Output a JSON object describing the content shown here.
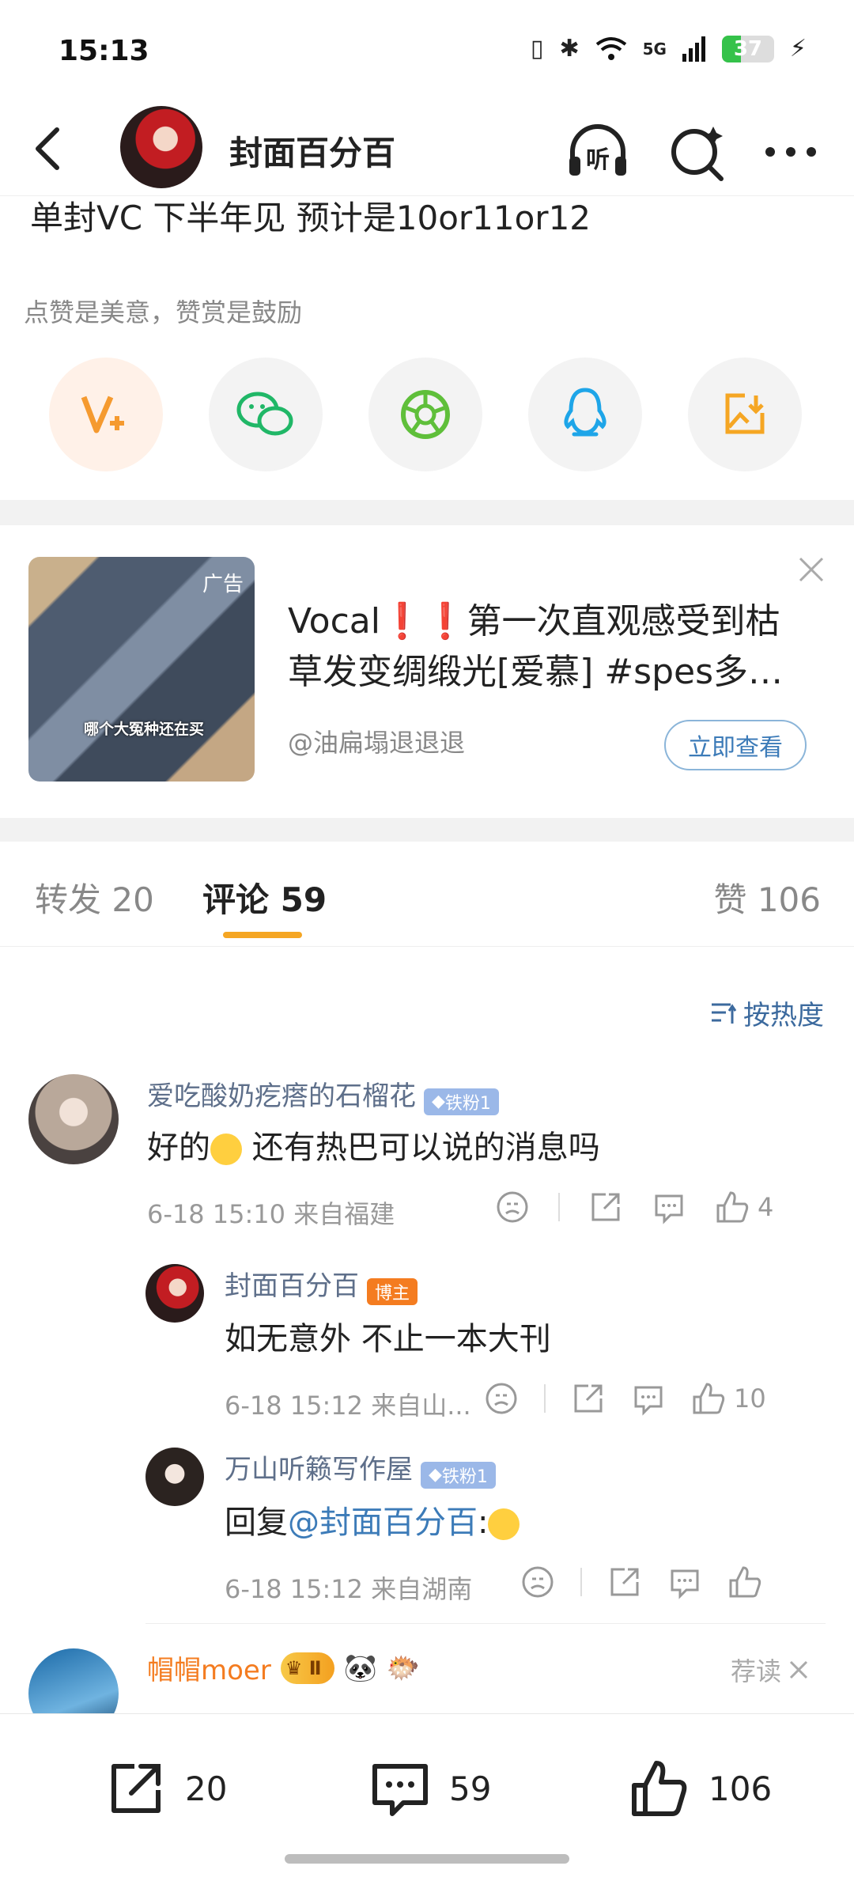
{
  "status_bar": {
    "time": "15:13",
    "network": "5G",
    "battery_level": "37"
  },
  "nav": {
    "title": "封面百分百",
    "listen_label": "听"
  },
  "post": {
    "text_fragment": "单封VC 下半年见 预计是10or11or12",
    "reward_tip": "点赞是美意，赞赏是鼓励",
    "share_targets": [
      "v-plus-icon",
      "wechat-icon",
      "moments-icon",
      "qq-icon",
      "save-image-icon"
    ]
  },
  "ad": {
    "tag": "广告",
    "image_caption": "哪个大冤种还在买",
    "title": "Vocal❗❗第一次直观感受到枯草发变绸缎光[爱慕] #spes多肽...",
    "author": "@油扁塌退退退",
    "cta": "立即查看"
  },
  "tabs": {
    "repost": "转发 20",
    "comments": "评论 59",
    "likes": "赞 106"
  },
  "sort_label": "按热度",
  "comments": [
    {
      "name": "爱吃酸奶疙瘩的石榴花",
      "badge": "铁粉1",
      "text_before": "好的",
      "text_after": " 还有热巴可以说的消息吗",
      "meta": "6-18 15:10  来自福建",
      "likes": "4"
    },
    {
      "name": "封面百分百",
      "badge": "博主",
      "text": "如无意外 不止一本大刊",
      "meta": "6-18 15:12  来自山...",
      "likes": "10"
    },
    {
      "name": "万山听籁写作屋",
      "badge": "铁粉1",
      "reply_prefix": "回复",
      "mention": "@封面百分百",
      "colon": ":",
      "meta": "6-18 15:12  来自湖南",
      "likes": ""
    },
    {
      "name": "帽帽moer",
      "level_badge": "Ⅱ",
      "recommend": "荐读"
    }
  ],
  "bottom_bar": {
    "repost_count": "20",
    "comment_count": "59",
    "like_count": "106"
  },
  "colors": {
    "accent": "#f5a623",
    "link": "#3c7bb8",
    "name": "#5e6f8a",
    "host_badge": "#f47c20",
    "fan_badge": "#9bb8e8"
  }
}
